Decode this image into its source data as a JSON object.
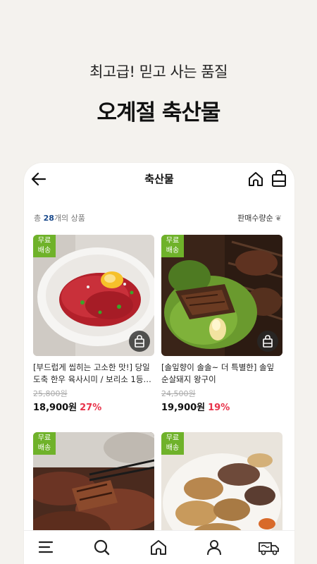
{
  "hero": {
    "subtitle": "최고급! 믿고 사는 품질",
    "title": "오계절 축산물"
  },
  "topbar": {
    "title": "축산물"
  },
  "list": {
    "count_prefix": "총 ",
    "count_num": "28",
    "count_suffix": "개의 상품",
    "sort_label": "판매수량순"
  },
  "products": [
    {
      "badge_line1": "무료",
      "badge_line2": "배송",
      "name": "[부드럽게 씹히는 고소한 맛!] 당일 도축 한우 육사시미 / 보리소 1등…",
      "old_price": "25,800원",
      "price": "18,900원",
      "discount": "27%"
    },
    {
      "badge_line1": "무료",
      "badge_line2": "배송",
      "name": "[솔잎향이 솔솔~ 더 특별한] 솔잎 순살돼지 왕구이",
      "old_price": "24,500원",
      "price": "19,900원",
      "discount": "19%"
    },
    {
      "badge_line1": "무료",
      "badge_line2": "배송"
    },
    {
      "badge_line1": "무료",
      "badge_line2": "배송"
    }
  ],
  "colors": {
    "badge": "#6fb22a",
    "discount": "#e8334a",
    "count_accent": "#1a4a8c"
  }
}
